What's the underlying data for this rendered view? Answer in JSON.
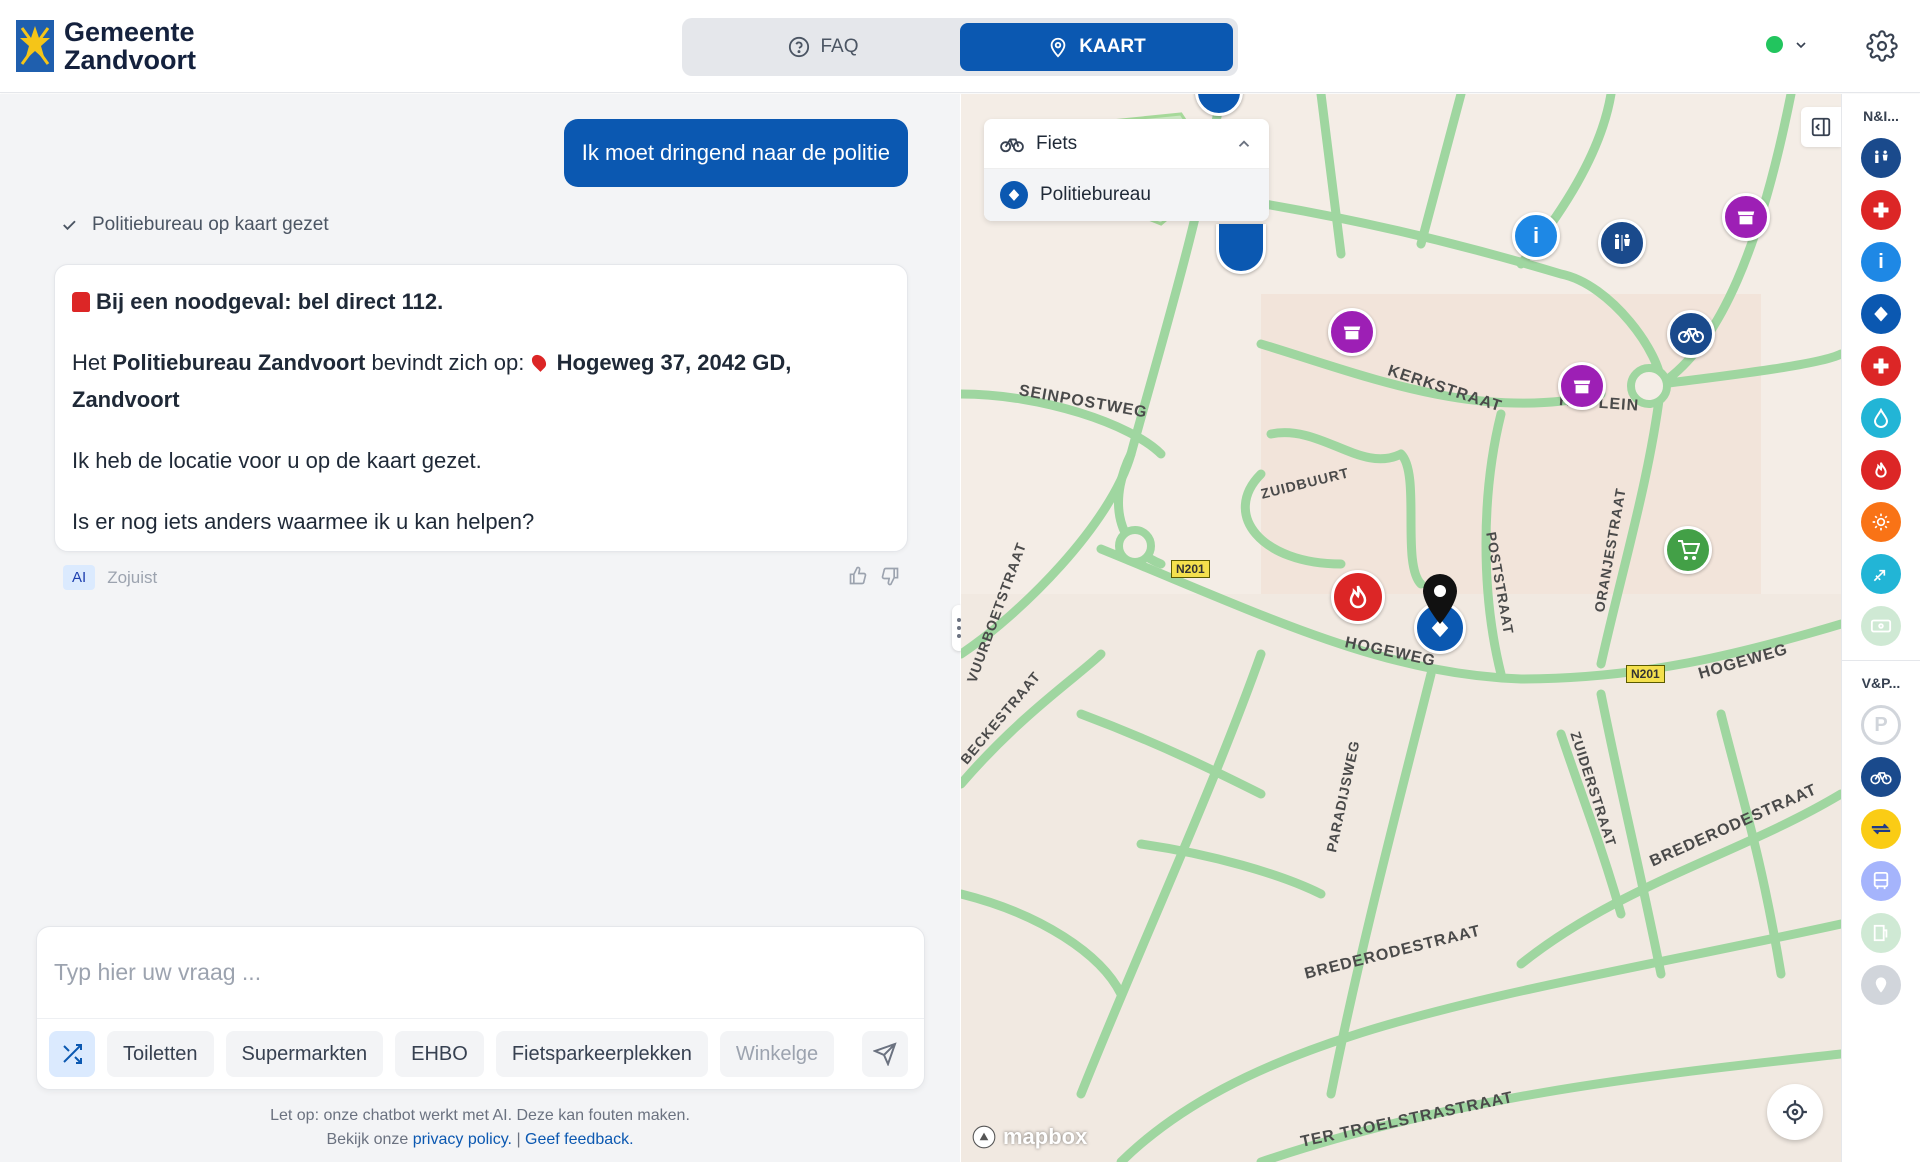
{
  "header": {
    "logo_line1": "Gemeente",
    "logo_line2": "Zandvoort",
    "tabs": [
      {
        "label": "FAQ"
      },
      {
        "label": "KAART"
      }
    ],
    "status_color": "#22c55e"
  },
  "chat": {
    "user_message": "Ik moet dringend naar de politie",
    "tool_status": "Politiebureau op kaart gezet",
    "answer": {
      "emergency": "Bij een noodgeval: bel direct 112.",
      "line1_a": "Het ",
      "line1_b": "Politiebureau Zandvoort",
      "line1_c": " bevindt zich op: ",
      "line1_d": "Hogeweg 37, 2042 GD, Zandvoort",
      "line2": "Ik heb de locatie voor u op de kaart gezet.",
      "line3": "Is er nog iets anders waarmee ik u kan helpen?"
    },
    "meta_badge": "AI",
    "meta_time": "Zojuist"
  },
  "composer": {
    "placeholder": "Typ hier uw vraag ...",
    "chips": [
      "Toiletten",
      "Supermarkten",
      "EHBO",
      "Fietsparkeerplekken",
      "Winkelge"
    ]
  },
  "disclaimer": {
    "line1": "Let op: onze chatbot werkt met AI. Deze kan fouten maken.",
    "line2_a": "Bekijk onze ",
    "privacy_link": "privacy policy.",
    "sep": " | ",
    "feedback_link": "Geef feedback."
  },
  "map": {
    "legend_title": "Fiets",
    "legend_item": "Politiebureau",
    "streets": {
      "kerkstraat": "KERKSTRAAT",
      "seinpostweg": "SEINPOSTWEG",
      "zuidbuurt": "ZUIDBUURT",
      "hogeweg1": "HOGEWEG",
      "hogeweg2": "HOGEWEG",
      "vuurboetstraat": "VUURBOETSTRAAT",
      "beckestraat": "BECKESTRAAT",
      "poststraat": "POSTSTRAAT",
      "zuiderstraat": "ZUIDERSTRAAT",
      "paradijsweg": "PARADIJSWEG",
      "oranjestraat": "ORANJESTRAAT",
      "bredrodestraat1": "BREDERODESTRAAT",
      "bredrodestraat2": "BREDERODESTRAAT",
      "troelstra": "TER TROELSTRASTRAAT",
      "plein": "K     LEIN",
      "n201a": "N201",
      "n201b": "N201"
    },
    "attribution": "mapbox"
  },
  "rail": {
    "title1": "N&I...",
    "title2": "V&P..."
  },
  "colors": {
    "brand": "#0b58b1",
    "police": "#0b58b1",
    "red": "#dc2626",
    "purple": "#9d1fb5",
    "green": "#43a047",
    "info": "#1e88e5"
  }
}
